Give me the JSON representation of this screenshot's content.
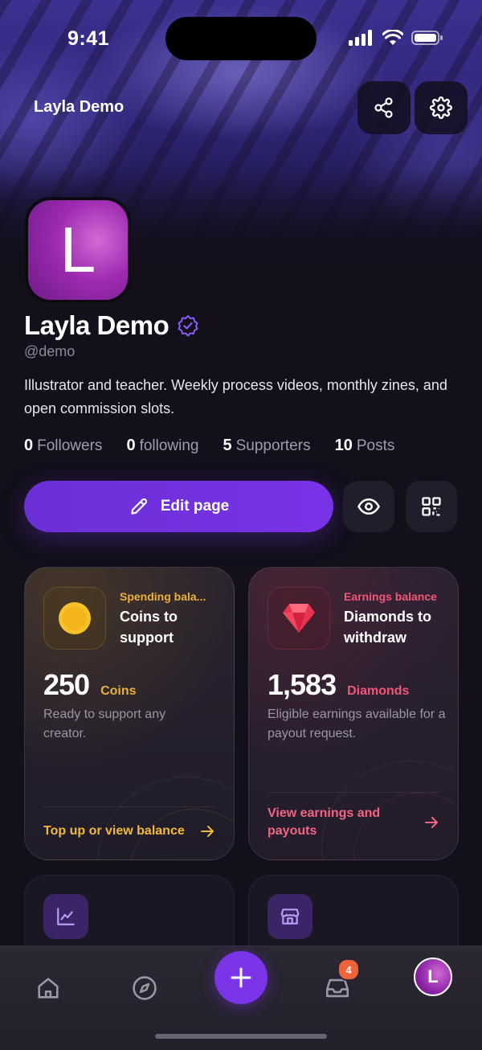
{
  "status_bar": {
    "time": "9:41"
  },
  "header": {
    "name": "Layla Demo",
    "share_icon": "share-icon",
    "settings_icon": "gear-icon"
  },
  "profile": {
    "avatar_letter": "L",
    "display_name": "Layla Demo",
    "verified_icon": "verified-badge-icon",
    "handle": "@demo",
    "bio": "Illustrator and teacher. Weekly process videos, monthly zines, and open commission slots.",
    "stats": [
      {
        "count": "0",
        "label": "Followers"
      },
      {
        "count": "0",
        "label": "following"
      },
      {
        "count": "5",
        "label": "Supporters"
      },
      {
        "count": "10",
        "label": "Posts"
      }
    ]
  },
  "actions": {
    "edit_label": "Edit page",
    "preview_icon": "eye-icon",
    "qr_icon": "qr-code-icon"
  },
  "cards": {
    "coins": {
      "tag": "Spending bala...",
      "title": "Coins to support",
      "amount": "250",
      "unit": "Coins",
      "description": "Ready to support any creator.",
      "link": "Top up or view balance",
      "accent": "#e9b13a"
    },
    "diamonds": {
      "tag": "Earnings balance",
      "title": "Diamonds to withdraw",
      "amount": "1,583",
      "unit": "Diamonds",
      "description": "Eligible earnings available for a payout request.",
      "link": "View earnings and payouts",
      "accent": "#f0567a"
    }
  },
  "more_cards": [
    {
      "icon": "chart-icon"
    },
    {
      "icon": "store-icon"
    }
  ],
  "tab_bar": {
    "items": [
      "home-icon",
      "compass-icon",
      "plus-icon",
      "inbox-icon",
      "profile-avatar"
    ],
    "inbox_badge": "4",
    "avatar_letter": "L",
    "accent": "#7b34e8"
  }
}
